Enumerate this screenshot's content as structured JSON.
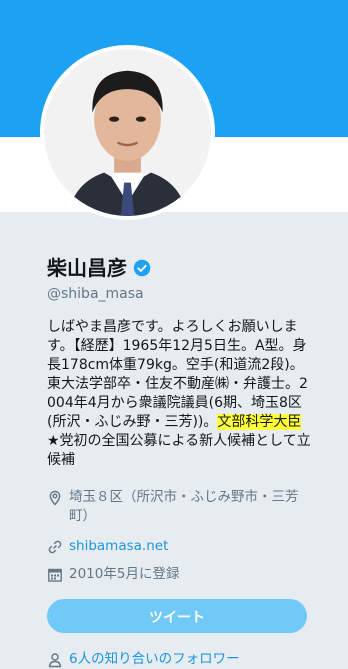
{
  "profile": {
    "name": "柴山昌彦",
    "handle": "@shiba_masa",
    "bio_before": "しばやま昌彦です。よろしくお願いします。【経歴】1965年12月5日生。A型。身長178cm体重79kg。空手(和道流2段)。東大法学部卒・住友不動産㈱・弁護士。2004年4月から衆議院議員(6期、埼玉8区(所沢・ふじみ野・三芳))。",
    "bio_highlight": "文部科学大臣",
    "bio_after": "★党初の全国公募による新人候補として立候補",
    "location": "埼玉８区（所沢市・ふじみ野市・三芳町）",
    "url": "shibamasa.net",
    "joined": "2010年5月に登録",
    "followers_text": "6人の知り合いのフォロワー"
  },
  "actions": {
    "tweet_label": "ツイート"
  },
  "colors": {
    "banner": "#1da1f2",
    "link": "#1b95e0",
    "button": "#71c9f8",
    "highlight": "#ffff3a"
  }
}
